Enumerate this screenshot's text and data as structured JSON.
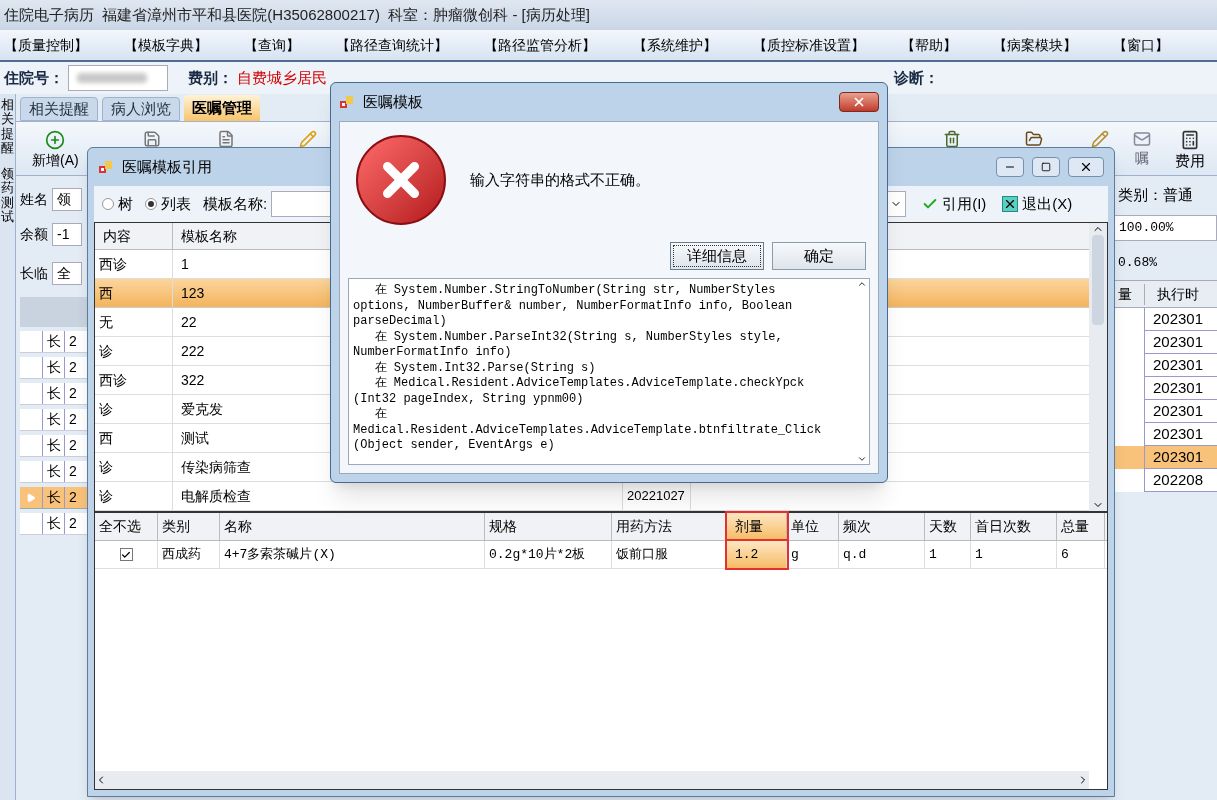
{
  "app": {
    "title": "住院电子病历  福建省漳州市平和县医院(H35062800217)  科室：肿瘤微创科 - [病历处理]"
  },
  "menu": [
    "【质量控制】",
    "【模板字典】",
    "【查询】",
    "【路径查询统计】",
    "【路径监管分析】",
    "【系统维护】",
    "【质控标准设置】",
    "【帮助】",
    "【病案模块】",
    "【窗口】"
  ],
  "patient": {
    "admission_label": "住院号：",
    "fee_label": "费别：",
    "fee_value": "自费城乡居民",
    "diagnosis_label": "诊断："
  },
  "side_tabs": [
    "相关提醒",
    "领药测试"
  ],
  "tabs": [
    {
      "label": "相关提醒",
      "selected": false
    },
    {
      "label": "病人浏览",
      "selected": false
    },
    {
      "label": "医嘱管理",
      "selected": true
    }
  ],
  "toolbar": {
    "new": "新增(A)",
    "advice": "嘱",
    "fee": "费用"
  },
  "left_panel": {
    "name_label": "姓名",
    "name_value": "领",
    "balance_label": "余额",
    "balance_value": "-1",
    "type_label": "长临",
    "type_value": "全",
    "rows": [
      {
        "type": "长",
        "value": "2",
        "selected": false
      },
      {
        "type": "长",
        "value": "2",
        "selected": false
      },
      {
        "type": "长",
        "value": "2",
        "selected": false
      },
      {
        "type": "长",
        "value": "2",
        "selected": false
      },
      {
        "type": "长",
        "value": "2",
        "selected": false
      },
      {
        "type": "长",
        "value": "2",
        "selected": false
      },
      {
        "type": "长",
        "value": "2",
        "selected": true
      },
      {
        "type": "长",
        "value": "2",
        "selected": false
      }
    ]
  },
  "right_panel": {
    "category": "类别：普通",
    "ratio_1": "100.00%",
    "ratio_2": "0.68%",
    "columns": [
      "量",
      "执行时"
    ],
    "rows": [
      {
        "time": "202301",
        "selected": false
      },
      {
        "time": "202301",
        "selected": false
      },
      {
        "time": "202301",
        "selected": false
      },
      {
        "time": "202301",
        "selected": false
      },
      {
        "time": "202301",
        "selected": false
      },
      {
        "time": "202301",
        "selected": false
      },
      {
        "time": "202301",
        "selected": true
      },
      {
        "time": "202208",
        "selected": false
      }
    ]
  },
  "template_window": {
    "title": "医嘱模板引用",
    "view_options": [
      {
        "label": "树",
        "selected": false
      },
      {
        "label": "列表",
        "selected": true
      }
    ],
    "name_label": "模板名称:",
    "ref_button": "引用(I)",
    "exit_button": "退出(X)",
    "template_table": {
      "columns": [
        "内容",
        "模板名称"
      ],
      "rows": [
        {
          "content": "西诊",
          "name": "1",
          "selected": false
        },
        {
          "content": "西",
          "name": "123",
          "selected": true
        },
        {
          "content": "无",
          "name": "22",
          "selected": false
        },
        {
          "content": "诊",
          "name": "222",
          "selected": false
        },
        {
          "content": "西诊",
          "name": "322",
          "selected": false
        },
        {
          "content": "诊",
          "name": "爱克发",
          "selected": false
        },
        {
          "content": "西",
          "name": "测试",
          "selected": false
        },
        {
          "content": "诊",
          "name": "传染病筛查",
          "selected": false
        },
        {
          "content": "诊",
          "name": "电解质检查",
          "column_3": "20221027",
          "selected": false
        }
      ]
    },
    "drug_table": {
      "columns": [
        {
          "label": "全不选",
          "highlighted": false
        },
        {
          "label": "类别",
          "highlighted": false
        },
        {
          "label": "名称",
          "highlighted": false
        },
        {
          "label": "规格",
          "highlighted": false
        },
        {
          "label": "用药方法",
          "highlighted": false
        },
        {
          "label": "剂量",
          "highlighted": true
        },
        {
          "label": "单位",
          "highlighted": false
        },
        {
          "label": "频次",
          "highlighted": false
        },
        {
          "label": "天数",
          "highlighted": false
        },
        {
          "label": "首日次数",
          "highlighted": false
        },
        {
          "label": "总量",
          "highlighted": false
        }
      ],
      "rows": [
        {
          "checked": true,
          "cells": [
            "",
            "西成药",
            "4+7多索茶碱片(X)",
            "0.2g*10片*2板",
            "饭前口服",
            "1.2",
            "g",
            "q.d",
            "1",
            "1",
            "6"
          ]
        }
      ]
    }
  },
  "dialog": {
    "title": "医嘱模板",
    "message": "输入字符串的格式不正确。",
    "buttons": [
      {
        "label": "详细信息",
        "focused": true
      },
      {
        "label": "确定",
        "focused": false
      }
    ],
    "details": [
      "   在 System.Number.StringToNumber(String str, NumberStyles",
      "options, NumberBuffer& number, NumberFormatInfo info, Boolean",
      "parseDecimal)",
      "   在 System.Number.ParseInt32(String s, NumberStyles style,",
      "NumberFormatInfo info)",
      "   在 System.Int32.Parse(String s)",
      "   在 Medical.Resident.AdviceTemplates.AdviceTemplate.checkYpck",
      "(Int32 pageIndex, String ypnm00)",
      "   在",
      "Medical.Resident.AdviceTemplates.AdviceTemplate.btnfiltrate_Click",
      "(Object sender, EventArgs e)"
    ]
  }
}
